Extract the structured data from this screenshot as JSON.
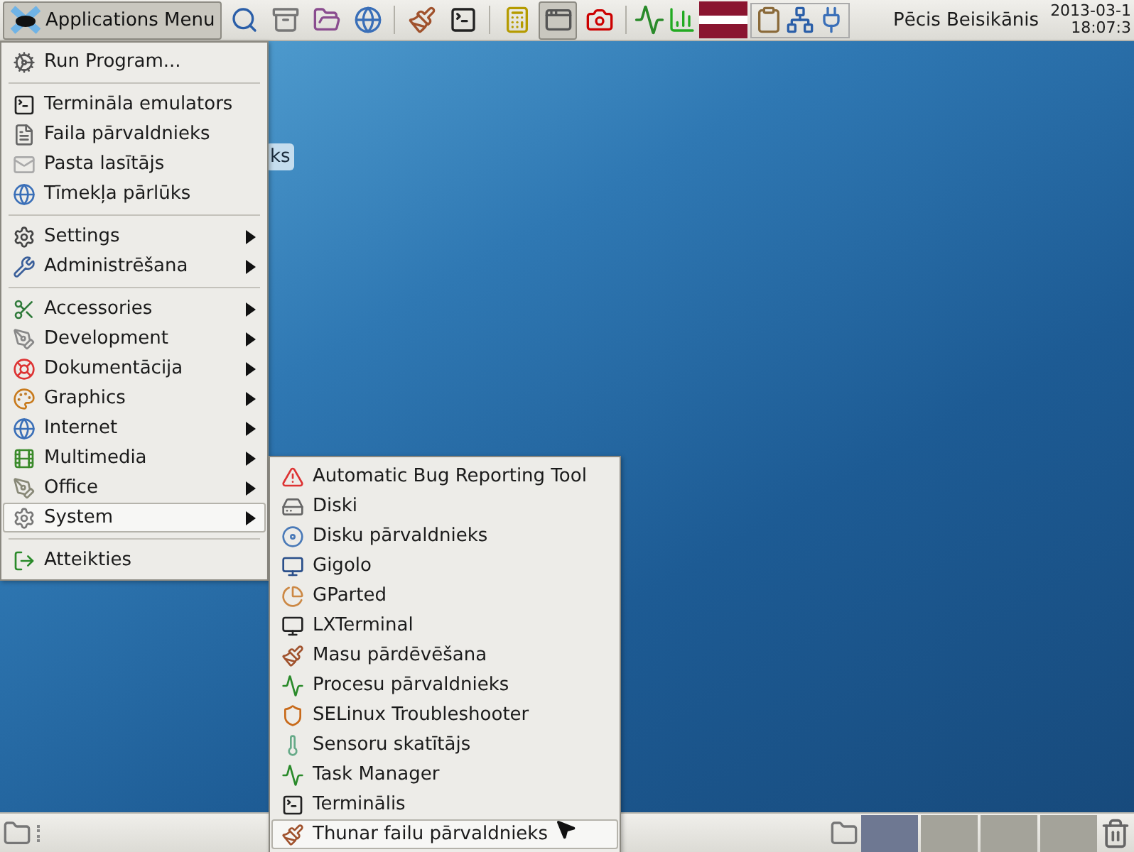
{
  "top_panel": {
    "app_menu_button": {
      "label": "Applications Menu",
      "selected": true
    },
    "launchers": [
      {
        "pressed": false
      },
      {
        "pressed": false
      },
      {
        "pressed": false
      },
      {
        "pressed": false
      },
      {
        "pressed": false
      },
      {
        "pressed": false
      },
      {
        "pressed": false
      },
      {
        "pressed": true
      },
      {
        "pressed": false
      }
    ],
    "user_name": "Pēcis Beisikānis",
    "clock": {
      "date": "2013-03-1",
      "time": "18:07:3"
    }
  },
  "desktop": {
    "icon_label": "ks"
  },
  "main_menu": {
    "sections": [
      [
        {
          "label": "Run Program...",
          "submenu": false,
          "selected": false
        }
      ],
      [
        {
          "label": "Termināla emulators",
          "submenu": false,
          "selected": false
        },
        {
          "label": "Faila pārvaldnieks",
          "submenu": false,
          "selected": false
        },
        {
          "label": "Pasta lasītājs",
          "submenu": false,
          "selected": false
        },
        {
          "label": "Tīmekļa pārlūks",
          "submenu": false,
          "selected": false
        }
      ],
      [
        {
          "label": "Settings",
          "submenu": true,
          "selected": false
        },
        {
          "label": "Administrēšana",
          "submenu": true,
          "selected": false
        }
      ],
      [
        {
          "label": "Accessories",
          "submenu": true,
          "selected": false
        },
        {
          "label": "Development",
          "submenu": true,
          "selected": false
        },
        {
          "label": "Dokumentācija",
          "submenu": true,
          "selected": false
        },
        {
          "label": "Graphics",
          "submenu": true,
          "selected": false
        },
        {
          "label": "Internet",
          "submenu": true,
          "selected": false
        },
        {
          "label": "Multimedia",
          "submenu": true,
          "selected": false
        },
        {
          "label": "Office",
          "submenu": true,
          "selected": false
        },
        {
          "label": "System",
          "submenu": true,
          "selected": true
        }
      ],
      [
        {
          "label": "Atteikties",
          "submenu": false,
          "selected": false
        }
      ]
    ]
  },
  "system_submenu": {
    "items": [
      {
        "label": "Automatic Bug Reporting Tool",
        "selected": false
      },
      {
        "label": "Diski",
        "selected": false
      },
      {
        "label": "Disku pārvaldnieks",
        "selected": false
      },
      {
        "label": "Gigolo",
        "selected": false
      },
      {
        "label": "GParted",
        "selected": false
      },
      {
        "label": "LXTerminal",
        "selected": false
      },
      {
        "label": "Masu pārdēvēšana",
        "selected": false
      },
      {
        "label": "Procesu pārvaldnieks",
        "selected": false
      },
      {
        "label": "SELinux Troubleshooter",
        "selected": false
      },
      {
        "label": "Sensoru skatītājs",
        "selected": false
      },
      {
        "label": "Task Manager",
        "selected": false
      },
      {
        "label": "Terminālis",
        "selected": false
      },
      {
        "label": "Thunar failu pārvaldnieks",
        "selected": true
      }
    ]
  },
  "bottom_panel": {
    "workspaces": [
      {
        "selected": true
      },
      {
        "selected": false
      },
      {
        "selected": false
      },
      {
        "selected": false
      }
    ]
  }
}
